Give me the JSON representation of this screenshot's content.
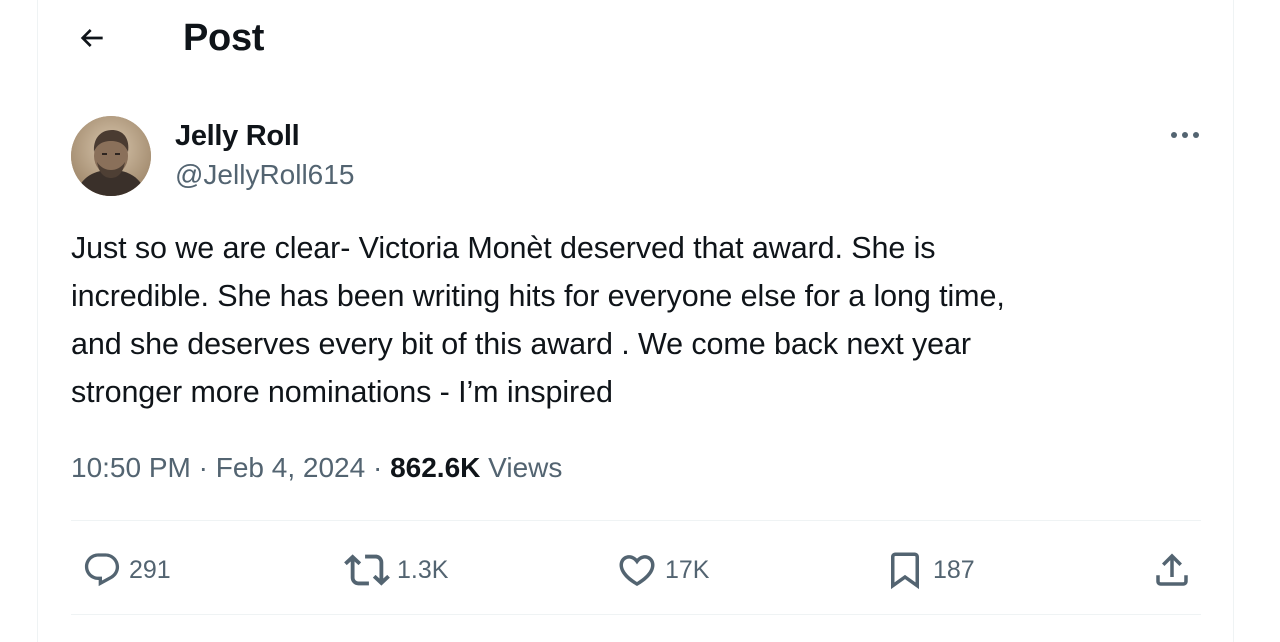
{
  "header": {
    "back_icon": "arrow-left-icon",
    "title": "Post"
  },
  "tweet": {
    "author": {
      "display_name": "Jelly Roll",
      "handle": "@JellyRoll615",
      "avatar_icon": "profile-avatar"
    },
    "more_icon": "more-horizontal-icon",
    "text": "Just so we are clear- Victoria Monèt deserved that award. She is\nincredible. She has been writing hits for everyone else for a long time,\nand she deserves every bit of this award . We come back next year\nstronger more nominations - I’m inspired",
    "time": "10:50 PM",
    "separator": "·",
    "date": "Feb 4, 2024",
    "views_count": "862.6K",
    "views_label": "Views"
  },
  "actions": {
    "reply": {
      "icon": "reply-icon",
      "count": "291"
    },
    "repost": {
      "icon": "repost-icon",
      "count": "1.3K"
    },
    "like": {
      "icon": "heart-icon",
      "count": "17K"
    },
    "bookmark": {
      "icon": "bookmark-icon",
      "count": "187"
    },
    "share": {
      "icon": "share-icon"
    }
  },
  "colors": {
    "text_primary": "#0f1419",
    "text_secondary": "#536471",
    "divider": "#eff3f4"
  }
}
